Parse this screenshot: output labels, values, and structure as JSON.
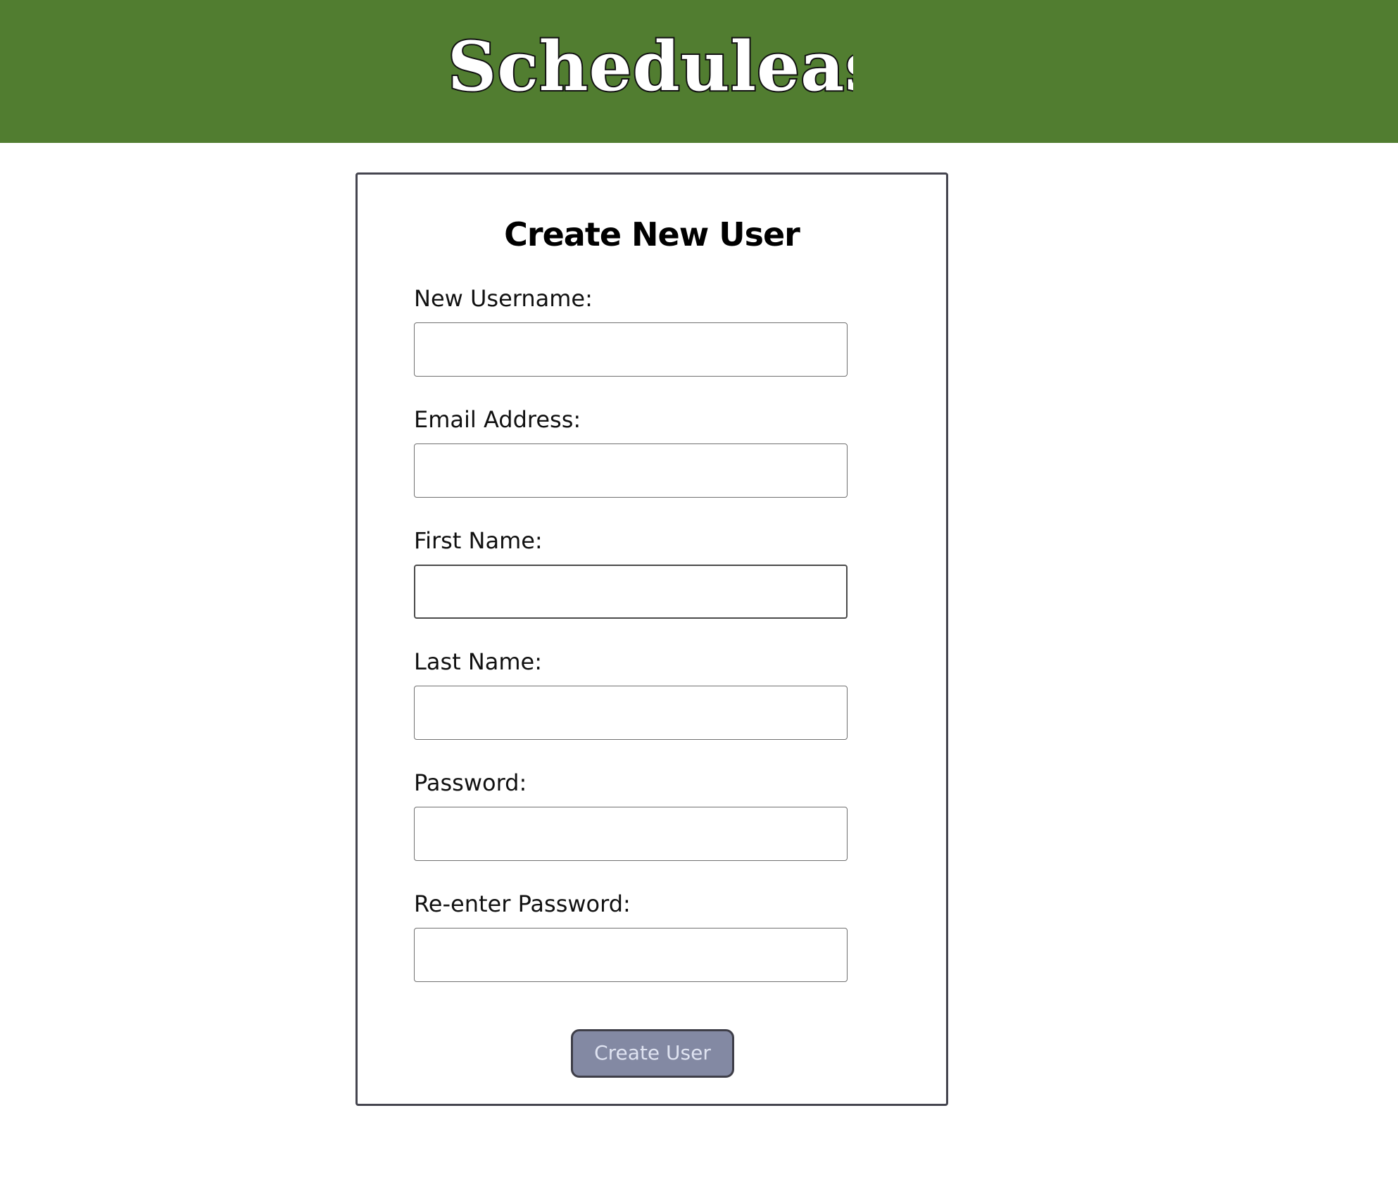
{
  "header": {
    "logo_text": "Schedulease",
    "background_color": "#517d30"
  },
  "form": {
    "title": "Create New User",
    "fields": [
      {
        "label": "New Username:",
        "value": "",
        "placeholder": ""
      },
      {
        "label": "Email Address:",
        "value": "",
        "placeholder": ""
      },
      {
        "label": "First Name:",
        "value": "",
        "placeholder": ""
      },
      {
        "label": "Last Name:",
        "value": "",
        "placeholder": ""
      },
      {
        "label": "Password:",
        "value": "",
        "placeholder": ""
      },
      {
        "label": "Re-enter Password:",
        "value": "",
        "placeholder": ""
      }
    ],
    "submit_label": "Create User",
    "submit_color": "#8389a3"
  }
}
